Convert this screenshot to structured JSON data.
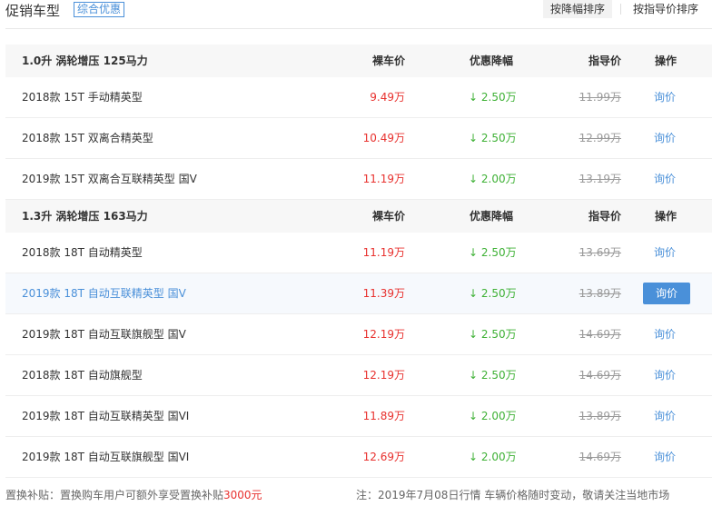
{
  "header": {
    "title": "促销车型",
    "combo_tag": "综合优惠",
    "sort_discount": "按降幅排序",
    "sort_guide": "按指导价排序"
  },
  "columns": {
    "price": "裸车价",
    "discount": "优惠降幅",
    "guide": "指导价",
    "action": "操作"
  },
  "groups": [
    {
      "title": "1.0升 涡轮增压 125马力",
      "rows": [
        {
          "name": "2018款 15T 手动精英型",
          "price": "9.49万",
          "discount": "↓ 2.50万",
          "guide": "11.99万",
          "action": "询价"
        },
        {
          "name": "2018款 15T 双离合精英型",
          "price": "10.49万",
          "discount": "↓ 2.50万",
          "guide": "12.99万",
          "action": "询价"
        },
        {
          "name": "2019款 15T 双离合互联精英型 国V",
          "price": "11.19万",
          "discount": "↓ 2.00万",
          "guide": "13.19万",
          "action": "询价"
        }
      ]
    },
    {
      "title": "1.3升 涡轮增压 163马力",
      "rows": [
        {
          "name": "2018款 18T 自动精英型",
          "price": "11.19万",
          "discount": "↓ 2.50万",
          "guide": "13.69万",
          "action": "询价"
        },
        {
          "name": "2019款 18T 自动互联精英型 国V",
          "price": "11.39万",
          "discount": "↓ 2.50万",
          "guide": "13.89万",
          "action": "询价",
          "highlighted": true
        },
        {
          "name": "2019款 18T 自动互联旗舰型 国V",
          "price": "12.19万",
          "discount": "↓ 2.50万",
          "guide": "14.69万",
          "action": "询价"
        },
        {
          "name": "2018款 18T 自动旗舰型",
          "price": "12.19万",
          "discount": "↓ 2.50万",
          "guide": "14.69万",
          "action": "询价"
        },
        {
          "name": "2019款 18T 自动互联精英型 国VI",
          "price": "11.89万",
          "discount": "↓ 2.00万",
          "guide": "13.89万",
          "action": "询价"
        },
        {
          "name": "2019款 18T 自动互联旗舰型 国VI",
          "price": "12.69万",
          "discount": "↓ 2.00万",
          "guide": "14.69万",
          "action": "询价"
        }
      ]
    }
  ],
  "footer": {
    "subsidy_text": "置换补贴：置换购车用户可额外享受置换补贴",
    "subsidy_amount": "3000元",
    "note": "注：2019年7月08日行情 车辆价格随时变动，敬请关注当地市场"
  },
  "colors": {
    "accent": "#4a90d9",
    "price": "#e8312e",
    "discount": "#3eb135",
    "muted": "#999999"
  }
}
